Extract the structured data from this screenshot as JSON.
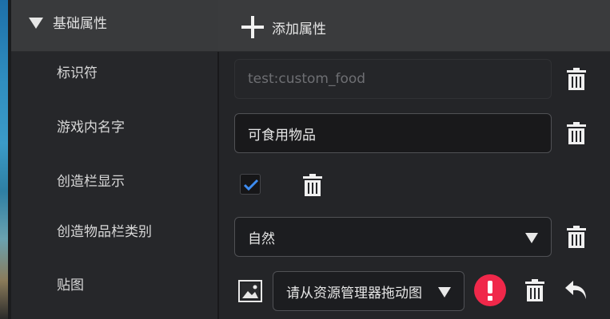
{
  "section": {
    "title": "基础属性",
    "add_label": "添加属性"
  },
  "rows": [
    {
      "label": "标识符",
      "value": "test:custom_food"
    },
    {
      "label": "游戏内名字",
      "value": "可食用物品"
    },
    {
      "label": "创造栏显示",
      "checked": true
    },
    {
      "label": "创造物品栏类别",
      "selected": "自然"
    },
    {
      "label": "贴图",
      "selected": "请从资源管理器拖动图"
    }
  ],
  "colors": {
    "header_bg": "#3a3b3d",
    "panel_bg": "#242528",
    "accent_blue": "#3d8cf0",
    "error_red": "#f0284a"
  },
  "icons": {
    "collapse": "triangle-down-icon",
    "add": "plus-icon",
    "delete": "trash-icon",
    "check": "check-icon",
    "image": "image-icon",
    "error": "exclamation-icon",
    "undo": "undo-icon"
  }
}
